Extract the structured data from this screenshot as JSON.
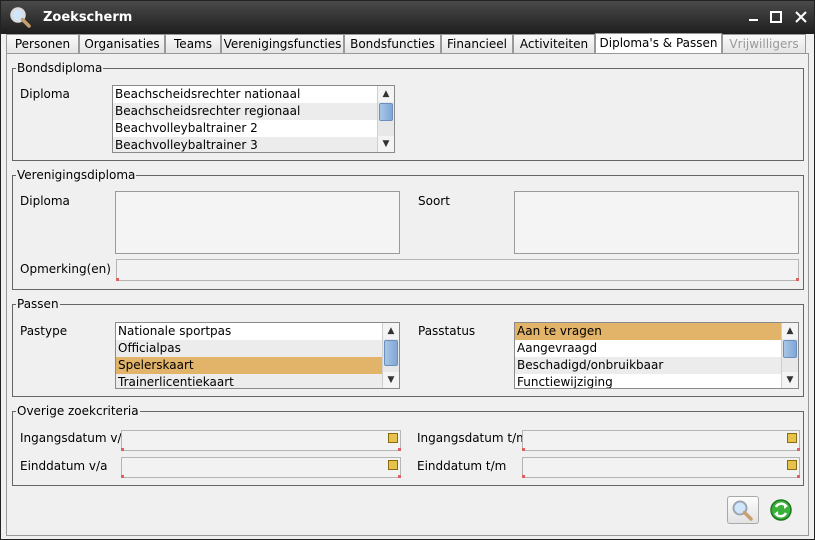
{
  "window": {
    "title": "Zoekscherm"
  },
  "tabs": [
    {
      "label": "Personen",
      "state": "normal"
    },
    {
      "label": "Organisaties",
      "state": "normal"
    },
    {
      "label": "Teams",
      "state": "normal"
    },
    {
      "label": "Verenigingsfuncties",
      "state": "normal"
    },
    {
      "label": "Bondsfuncties",
      "state": "normal"
    },
    {
      "label": "Financieel",
      "state": "normal"
    },
    {
      "label": "Activiteiten",
      "state": "normal"
    },
    {
      "label": "Diploma's & Passen",
      "state": "active"
    },
    {
      "label": "Vrijwilligers",
      "state": "disabled"
    }
  ],
  "bondsdiploma": {
    "legend": "Bondsdiploma",
    "diploma_label": "Diploma",
    "items": [
      "Beachscheidsrechter nationaal",
      "Beachscheidsrechter regionaal",
      "Beachvolleybaltrainer 2",
      "Beachvolleybaltrainer 3"
    ]
  },
  "verenigingsdiploma": {
    "legend": "Verenigingsdiploma",
    "diploma_label": "Diploma",
    "soort_label": "Soort",
    "opmerking_label": "Opmerking(en)"
  },
  "passen": {
    "legend": "Passen",
    "pastype_label": "Pastype",
    "pastype_items": [
      "Nationale sportpas",
      "Officialpas",
      "Spelerskaart",
      "Trainerlicentiekaart"
    ],
    "pastype_selected": "Spelerskaart",
    "passtatus_label": "Passtatus",
    "passtatus_items": [
      "Aan te vragen",
      "Aangevraagd",
      "Beschadigd/onbruikbaar",
      "Functiewijziging"
    ],
    "passtatus_selected": "Aan te vragen"
  },
  "overige": {
    "legend": "Overige zoekcriteria",
    "ingang_va": "Ingangsdatum v/a",
    "ingang_tm": "Ingangsdatum t/m",
    "eind_va": "Einddatum v/a",
    "eind_tm": "Einddatum t/m"
  },
  "colors": {
    "selection": "#e2b469",
    "titlebar": "#2a2a2a"
  }
}
